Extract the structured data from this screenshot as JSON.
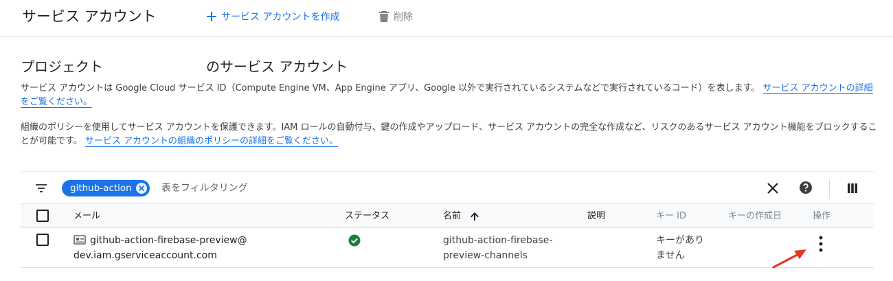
{
  "header": {
    "title": "サービス アカウント",
    "create_label": "サービス アカウントを作成",
    "delete_label": "削除"
  },
  "section": {
    "title_prefix": "プロジェクト",
    "title_suffix": "のサービス アカウント",
    "description1": "サービス アカウントは Google Cloud サービス ID（Compute Engine VM、App Engine アプリ、Google 以外で実行されているシステムなどで実行されているコード）を表します。",
    "link1": "サービス アカウントの詳細をご覧ください。",
    "description2": "組織のポリシーを使用してサービス アカウントを保護できます。IAM ロールの自動付与、鍵の作成やアップロード、サービス アカウントの完全な作成など、リスクのあるサービス アカウント機能をブロックすることが可能です。",
    "link2": "サービス アカウントの組織のポリシーの詳細をご覧ください。"
  },
  "filter": {
    "chip_label": "github-action",
    "placeholder": "表をフィルタリング"
  },
  "table": {
    "columns": {
      "email": "メール",
      "status": "ステータス",
      "name": "名前",
      "description": "説明",
      "key_id": "キー ID",
      "key_created": "キーの作成日",
      "actions": "操作"
    },
    "rows": [
      {
        "email_line1": "github-action-firebase-preview@",
        "email_line2": "dev.iam.gserviceaccount.com",
        "status": "ok",
        "name": "github-action-firebase-preview-channels",
        "description": "",
        "key_id": "キーがありません",
        "key_created": ""
      }
    ]
  },
  "icons": {
    "create": "plus-icon",
    "delete": "trash-icon",
    "filter": "filter-icon",
    "chip_remove": "close-circle-icon",
    "clear": "close-icon",
    "help": "help-circle-icon",
    "columns": "columns-icon",
    "sort": "arrow-up-icon",
    "service_account": "service-account-key-icon",
    "status_ok": "check-circle-icon",
    "row_menu": "more-vert-icon",
    "annotation": "red-arrow"
  },
  "colors": {
    "accent": "#1a73e8",
    "status_ok": "#188038",
    "annotation": "#ea3323",
    "muted": "#80868b"
  }
}
